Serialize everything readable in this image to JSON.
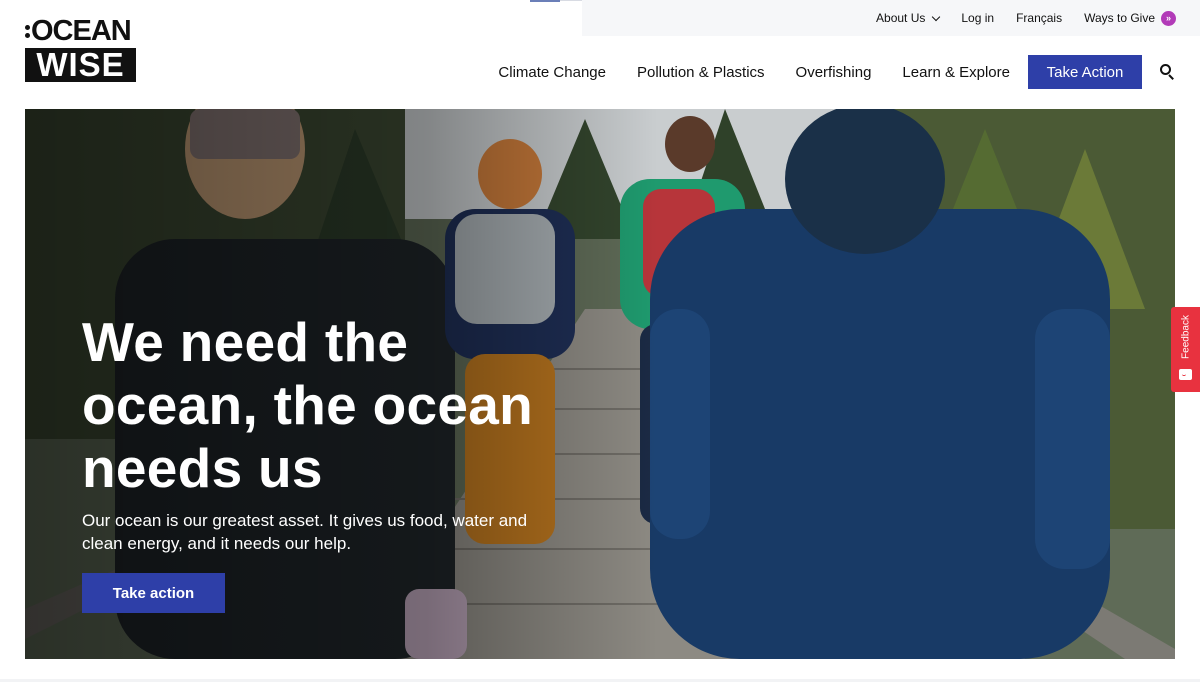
{
  "logo": {
    "line1": "OCEAN",
    "line2": "WISE"
  },
  "utility_nav": {
    "about": "About Us",
    "login": "Log in",
    "language": "Français",
    "give": "Ways to Give"
  },
  "main_nav": {
    "items": [
      "Climate Change",
      "Pollution & Plastics",
      "Overfishing",
      "Learn & Explore"
    ],
    "cta": "Take Action"
  },
  "hero": {
    "title": "We need the ocean, the ocean needs us",
    "subtitle": "Our ocean is our greatest asset. It gives us food, water and clean energy, and it needs our help.",
    "button": "Take action"
  },
  "feedback": {
    "label": "Feedback"
  },
  "colors": {
    "brand_blue": "#2e3fa8",
    "give_purple": "#b23bb8",
    "feedback_red": "#e8323f"
  },
  "icons": [
    "chevron-down-icon",
    "double-chevron-right-icon",
    "search-icon",
    "feedback-icon"
  ]
}
